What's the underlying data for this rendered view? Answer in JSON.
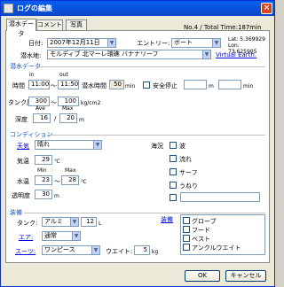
{
  "window": {
    "title": "ログの編集",
    "close": "×"
  },
  "tabs": [
    "潜水データ",
    "コメント",
    "写真"
  ],
  "info": {
    "number": "No.4 / Total Time:187min",
    "lat": "Lat: 5.369929",
    "lon": "Lon: 73.625905"
  },
  "dive": {
    "date_label": "日付:",
    "date_value": "2007年12月11日",
    "entry_label": "エントリー:",
    "entry_value": "ボート",
    "site_label": "潜水地:",
    "site_value": "モルディブ  北マーレ環礁  バナナリーフ",
    "virtual_earth": "Virtual Earth."
  },
  "data_section": {
    "title": "潜水データ",
    "in_label": "in",
    "out_label": "out",
    "time_label": "時間",
    "time_in": "11:00",
    "time_out": "11:50",
    "dive_time_label": "潜水時間",
    "dive_time": "50",
    "min_unit": "min",
    "safety_stop_label": "安全停止",
    "m_unit": "m",
    "safety_min_unit": "min",
    "tank_label": "タンク圧",
    "tank_in": "300",
    "tank_out": "100",
    "pressure_unit": "kg/cm2",
    "avg_label": "Ave",
    "max_label": "Max",
    "depth_label": "深度",
    "depth_avg": "16",
    "depth_max": "20",
    "depth_unit": "m",
    "tilde": "〜",
    "slash": "/"
  },
  "condition": {
    "title": "コンディション",
    "weather_label": "天気",
    "weather_value": "晴れ",
    "air_label": "気温",
    "air_value": "29",
    "temp_unit": "℃",
    "min_label": "Min",
    "max_label": "Max",
    "water_label": "水温",
    "water_min": "23",
    "water_max": "28",
    "visibility_label": "透明度",
    "visibility_value": "30",
    "vis_unit": "m",
    "sea_label": "海況",
    "sea_options": [
      "波",
      "流れ",
      "サーフ",
      "うねり"
    ]
  },
  "equipment": {
    "title": "装備",
    "tank_label": "タンク:",
    "tank_value": "アルミ",
    "tank_size": "12",
    "tank_unit": "L",
    "air_label": "エア:",
    "air_value": "通常",
    "suit_label": "スーツ:",
    "suit_value": "ワンピース",
    "weight_label": "ウエイト:",
    "weight_value": "5",
    "weight_unit": "kg",
    "gear_label": "装備",
    "gear_items": [
      "グローブ",
      "フード",
      "ベスト",
      "アンクルウエイト"
    ]
  },
  "buttons": {
    "ok": "OK",
    "cancel": "キャンセル"
  }
}
